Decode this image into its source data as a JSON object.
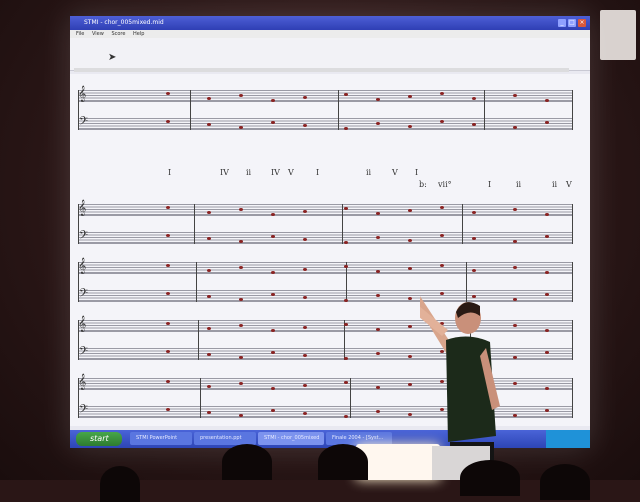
{
  "window": {
    "title": "STMI - chor_005mixed.mid",
    "menus": [
      "File",
      "View",
      "Score",
      "Help"
    ]
  },
  "analysis": {
    "row1": [
      "I",
      "IV",
      "ii",
      "IV",
      "V",
      "I",
      "ii",
      "V",
      "I",
      "I",
      "ii",
      "ii",
      "V"
    ],
    "row2": [
      "b:",
      "vii°"
    ]
  },
  "taskbar": {
    "start_label": "start",
    "tasks": [
      "STMI PowerPoint",
      "presentation.ppt",
      "STMI - chor_005mixed",
      "Finale 2004 - [Syst..."
    ]
  },
  "colors": {
    "screen": "#e9e9f1",
    "titlebar": "#2f3fb4",
    "taskbar": "#2d45b5",
    "start": "#2e7b30",
    "note": "#8a2222",
    "room": "#2b1717"
  }
}
